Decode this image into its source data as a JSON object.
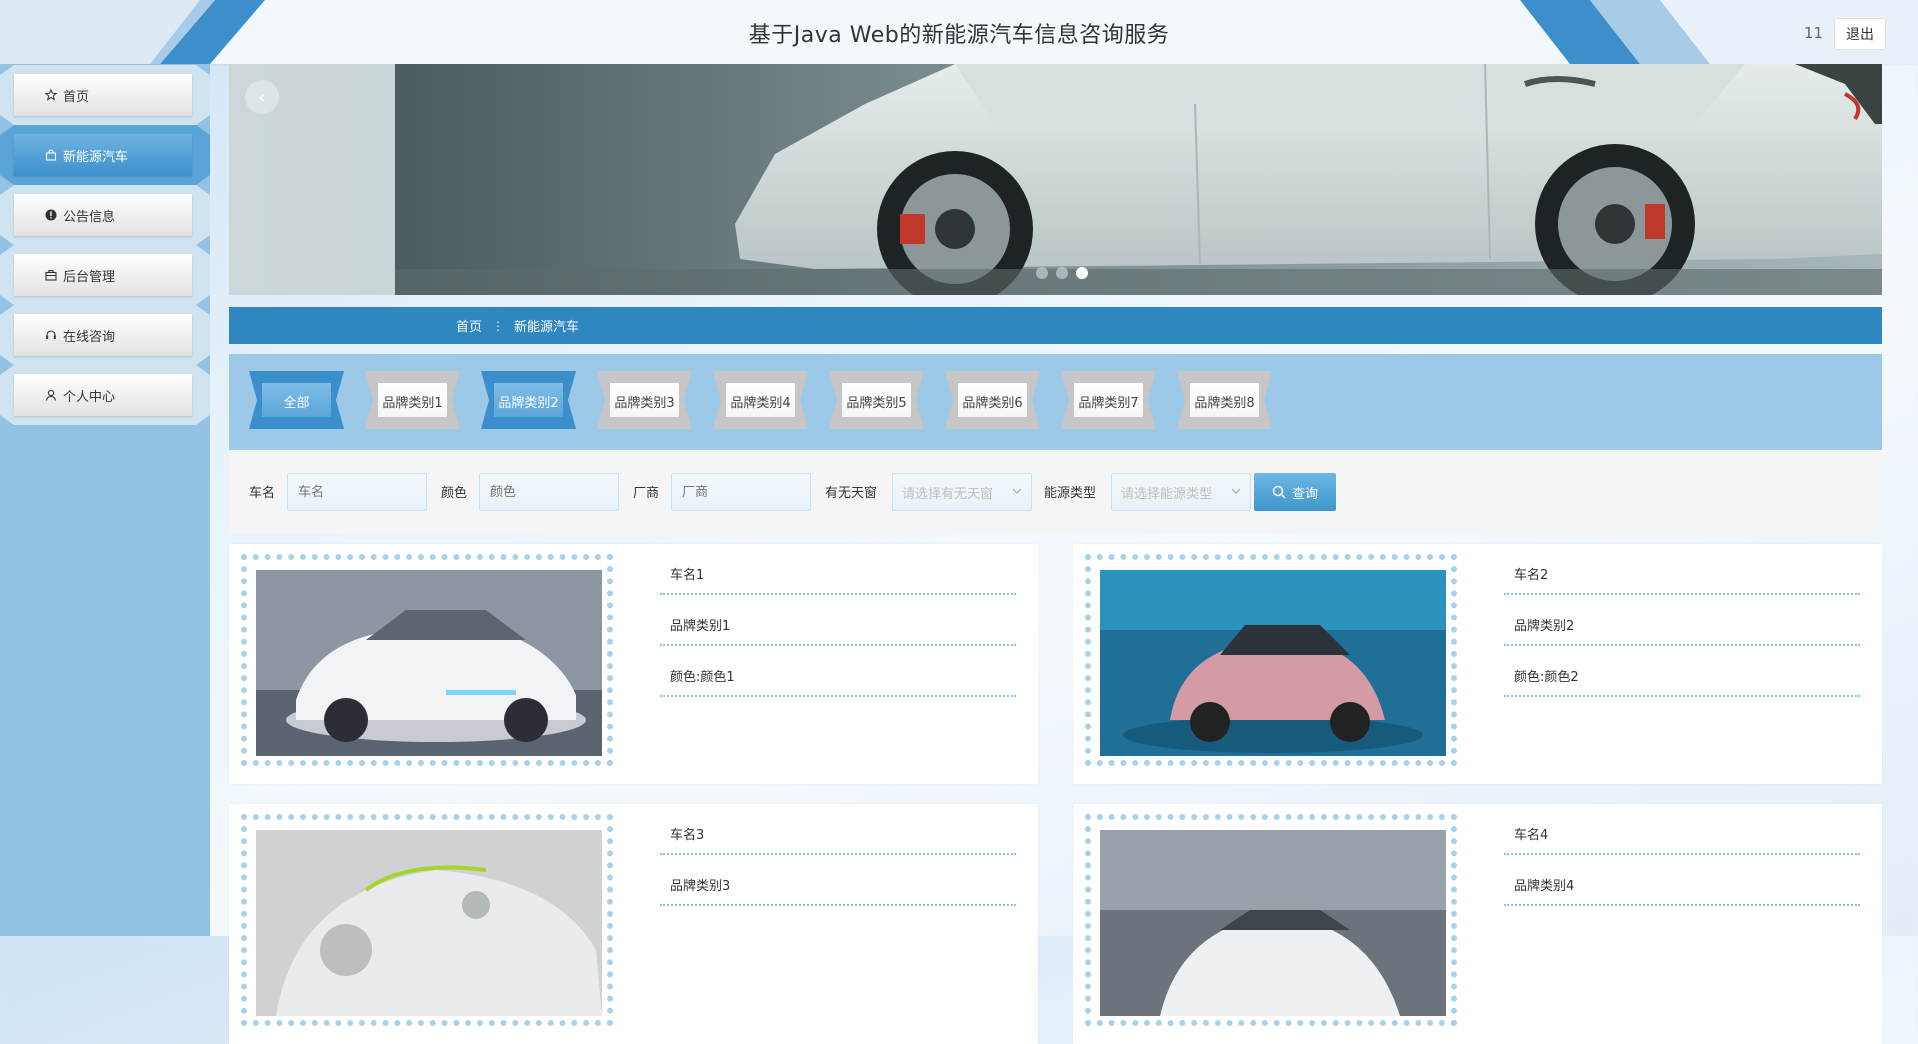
{
  "header": {
    "title": "基于Java Web的新能源汽车信息咨询服务",
    "username": "11",
    "logout_label": "退出"
  },
  "sidebar": {
    "items": [
      {
        "label": "首页",
        "icon": "star-icon",
        "active": false
      },
      {
        "label": "新能源汽车",
        "icon": "shopping-bag-icon",
        "active": true
      },
      {
        "label": "公告信息",
        "icon": "info-circle-icon",
        "active": false
      },
      {
        "label": "后台管理",
        "icon": "briefcase-icon",
        "active": false
      },
      {
        "label": "在线咨询",
        "icon": "headset-icon",
        "active": false
      },
      {
        "label": "个人中心",
        "icon": "user-icon",
        "active": false
      }
    ]
  },
  "carousel": {
    "active_slide": 3,
    "slide_count": 3
  },
  "breadcrumb": {
    "home": "首页",
    "separator": "⋮",
    "current": "新能源汽车"
  },
  "category_tabs": {
    "selected": "品牌类别2",
    "items": [
      "全部",
      "品牌类别1",
      "品牌类别2",
      "品牌类别3",
      "品牌类别4",
      "品牌类别5",
      "品牌类别6",
      "品牌类别7",
      "品牌类别8"
    ]
  },
  "search": {
    "name_label": "车名",
    "name_placeholder": "车名",
    "color_label": "颜色",
    "color_placeholder": "颜色",
    "maker_label": "厂商",
    "maker_placeholder": "厂商",
    "sunroof_label": "有无天窗",
    "sunroof_placeholder": "请选择有无天窗",
    "energy_label": "能源类型",
    "energy_placeholder": "请选择能源类型",
    "query_label": "查询"
  },
  "cars": [
    {
      "name": "车名1",
      "brand": "品牌类别1",
      "color": "颜色:颜色1"
    },
    {
      "name": "车名2",
      "brand": "品牌类别2",
      "color": "颜色:颜色2"
    },
    {
      "name": "车名3",
      "brand": "品牌类别3",
      "color": ""
    },
    {
      "name": "车名4",
      "brand": "品牌类别4",
      "color": ""
    }
  ],
  "colors": {
    "accent": "#2f87bf",
    "sidebar_bg": "#93c2e4",
    "filter_bg": "#9dc9e8",
    "active_button": "#4a9bd1"
  }
}
